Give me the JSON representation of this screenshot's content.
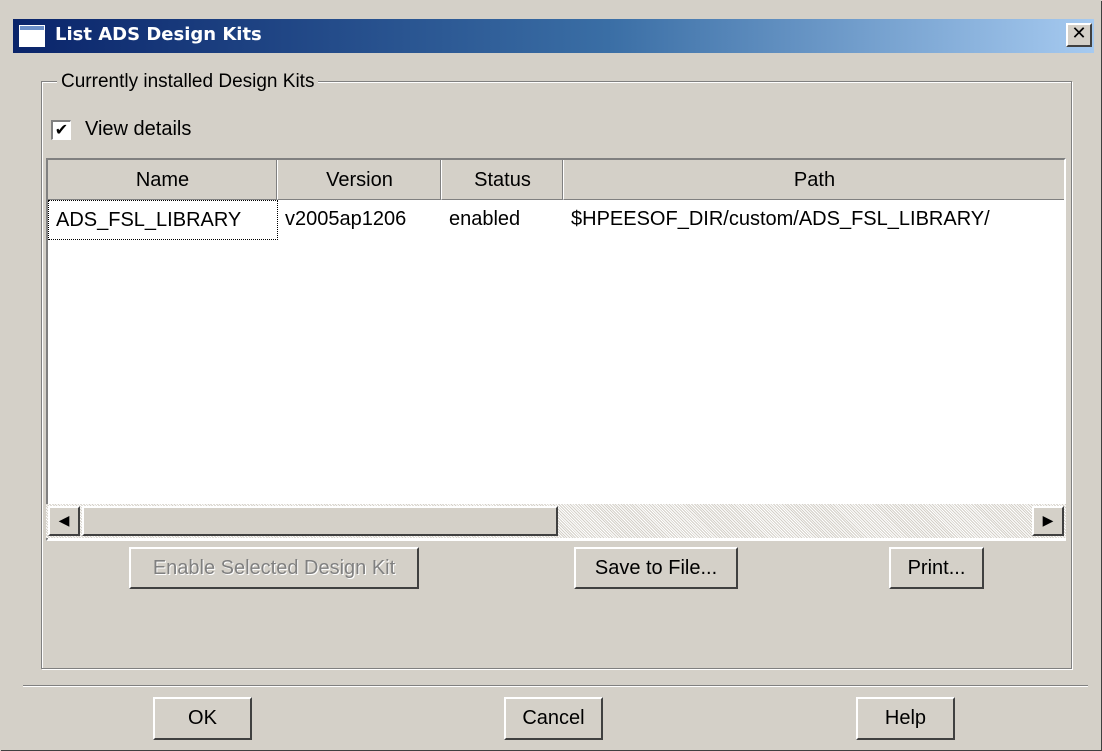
{
  "window": {
    "title": "List ADS Design Kits",
    "close_glyph": "✕"
  },
  "group": {
    "label": "Currently installed Design Kits"
  },
  "view_details": {
    "label": "View details",
    "checked": true,
    "check_glyph": "✔"
  },
  "table": {
    "columns": [
      "Name",
      "Version",
      "Status",
      "Path"
    ],
    "rows": [
      [
        "ADS_FSL_LIBRARY",
        "v2005ap1206",
        "enabled",
        "$HPEESOF_DIR/custom/ADS_FSL_LIBRARY/"
      ]
    ]
  },
  "scrollbar": {
    "left_glyph": "◀",
    "right_glyph": "▶"
  },
  "actions": {
    "enable_label": "Enable Selected Design Kit",
    "save_label": "Save to File...",
    "print_label": "Print..."
  },
  "footer": {
    "ok_label": "OK",
    "cancel_label": "Cancel",
    "help_label": "Help"
  },
  "colors": {
    "titlebar_start": "#0a246a",
    "titlebar_end": "#a6caf0",
    "face": "#d4d0c8"
  }
}
